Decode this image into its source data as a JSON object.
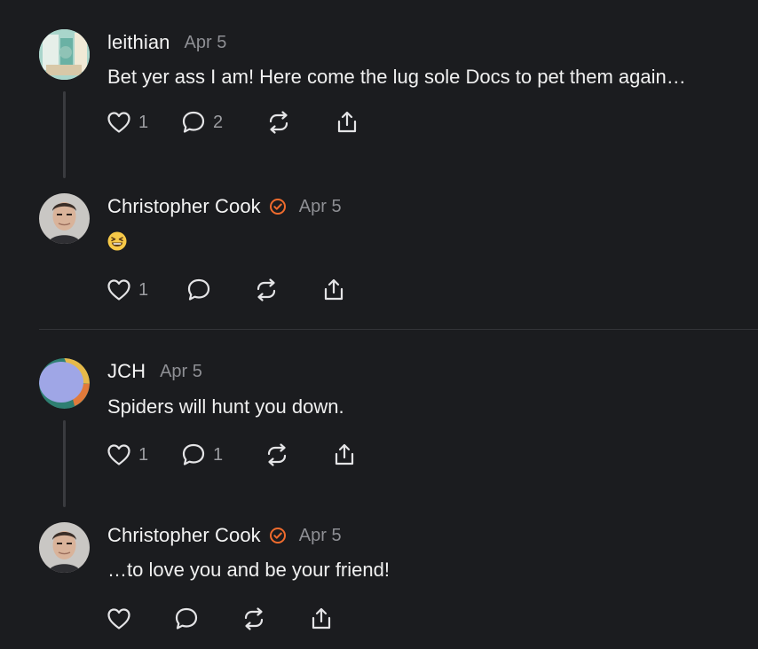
{
  "colors": {
    "background": "#1b1c1f",
    "text_primary": "#f2f2f2",
    "text_secondary": "#8e8f94",
    "verified_accent": "#ef6b2d"
  },
  "posts": [
    {
      "username": "leithian",
      "date": "Apr 5",
      "verified": false,
      "text": "Bet yer ass I am! Here come the lug sole Docs to pet them again…",
      "likes": "1",
      "replies": "2"
    },
    {
      "username": "Christopher Cook",
      "date": "Apr 5",
      "verified": true,
      "emoji": "grinning-squinting-face",
      "likes": "1",
      "replies": ""
    },
    {
      "username": "JCH",
      "date": "Apr 5",
      "verified": false,
      "text": "Spiders will hunt you down.",
      "likes": "1",
      "replies": "1"
    },
    {
      "username": "Christopher Cook",
      "date": "Apr 5",
      "verified": true,
      "text": "…to love you and be your friend!",
      "likes": "",
      "replies": ""
    }
  ],
  "icons": {
    "like": "heart-icon",
    "reply": "comment-bubble-icon",
    "repost": "repost-icon",
    "share": "share-icon",
    "verified": "verified-badge-icon"
  }
}
